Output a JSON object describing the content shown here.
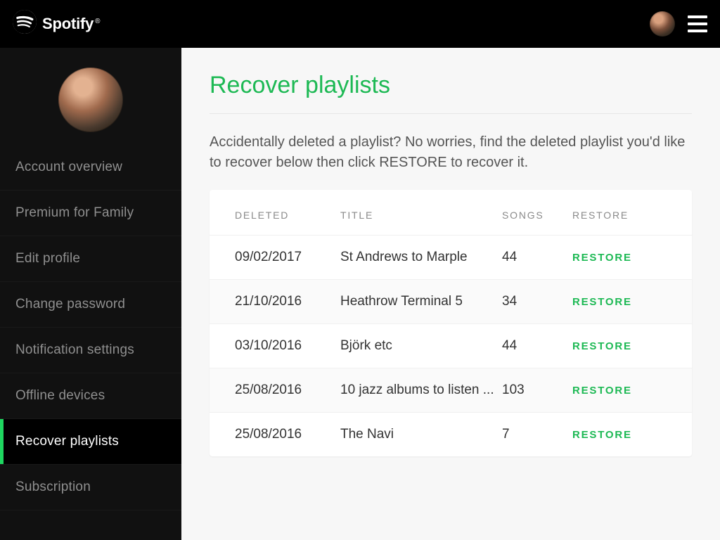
{
  "header": {
    "brand": "Spotify"
  },
  "sidebar": {
    "items": [
      {
        "label": "Account overview",
        "active": false
      },
      {
        "label": "Premium for Family",
        "active": false
      },
      {
        "label": "Edit profile",
        "active": false
      },
      {
        "label": "Change password",
        "active": false
      },
      {
        "label": "Notification settings",
        "active": false
      },
      {
        "label": "Offline devices",
        "active": false
      },
      {
        "label": "Recover playlists",
        "active": true
      },
      {
        "label": "Subscription",
        "active": false
      }
    ]
  },
  "main": {
    "title": "Recover playlists",
    "description": "Accidentally deleted a playlist? No worries, find the deleted playlist you'd like to recover below then click RESTORE to recover it.",
    "columns": {
      "deleted": "DELETED",
      "title": "TITLE",
      "songs": "SONGS",
      "restore": "RESTORE"
    },
    "restore_label": "RESTORE",
    "rows": [
      {
        "deleted": "09/02/2017",
        "title": "St Andrews to Marple",
        "songs": "44"
      },
      {
        "deleted": "21/10/2016",
        "title": "Heathrow Terminal 5",
        "songs": "34"
      },
      {
        "deleted": "03/10/2016",
        "title": "Björk etc",
        "songs": "44"
      },
      {
        "deleted": "25/08/2016",
        "title": "10 jazz albums to listen ...",
        "songs": "103"
      },
      {
        "deleted": "25/08/2016",
        "title": "The Navi",
        "songs": "7"
      }
    ]
  }
}
